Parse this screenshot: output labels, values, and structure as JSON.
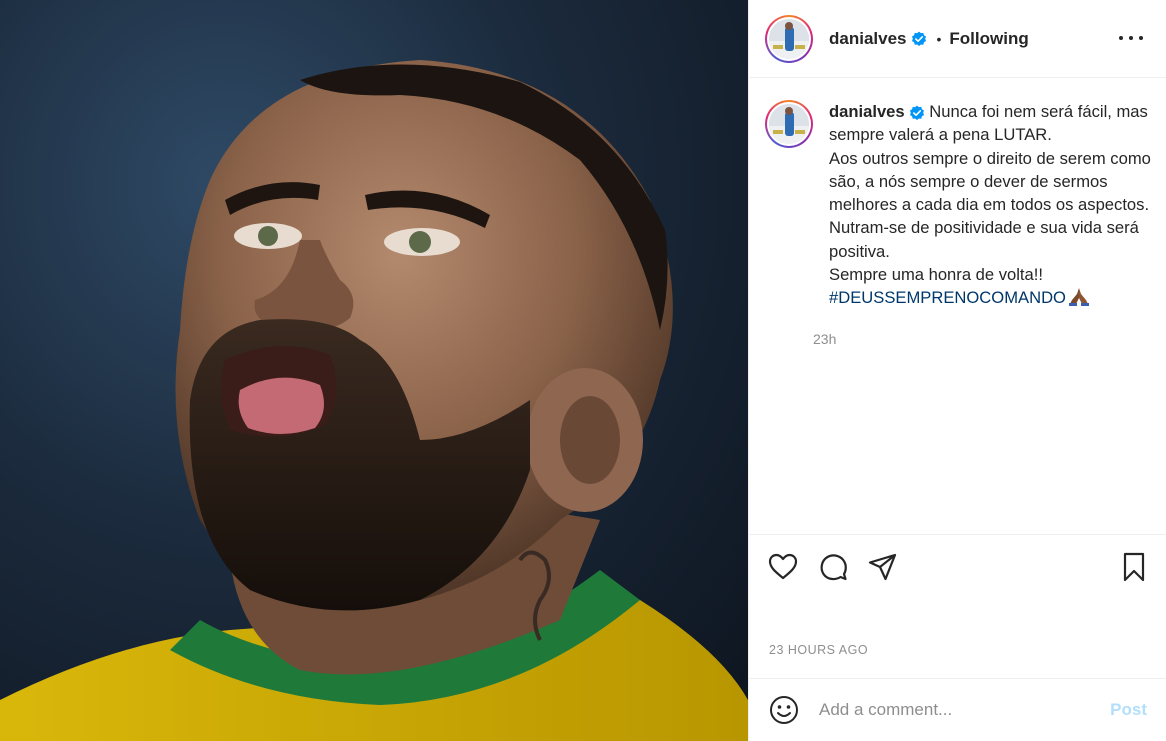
{
  "post": {
    "username": "danialves",
    "verified": true,
    "separator": "•",
    "follow_status": "Following",
    "caption": {
      "username": "danialves",
      "text": "Nunca foi nem será fácil, mas sempre valerá a pena LUTAR.\nAos outros sempre o direito de serem como são, a nós sempre o dever de sermos melhores a cada dia em todos os aspectos.\nNutram-se de positividade e sua vida será positiva.\nSempre uma honra de volta!!\n",
      "hashtag": "#DEUSSEMPRENOCOMANDO",
      "emoji": "pray-emoji",
      "time": "23h"
    },
    "timestamp": "23 HOURS AGO"
  },
  "actions": {
    "like": "heart-icon",
    "comment": "comment-icon",
    "share": "send-icon",
    "save": "bookmark-icon"
  },
  "comment": {
    "placeholder": "Add a comment...",
    "post_label": "Post"
  },
  "colors": {
    "verified": "#0095f6",
    "hashtag": "#00376b",
    "muted": "#8e8e8e",
    "post_disabled": "#b2dffc"
  }
}
